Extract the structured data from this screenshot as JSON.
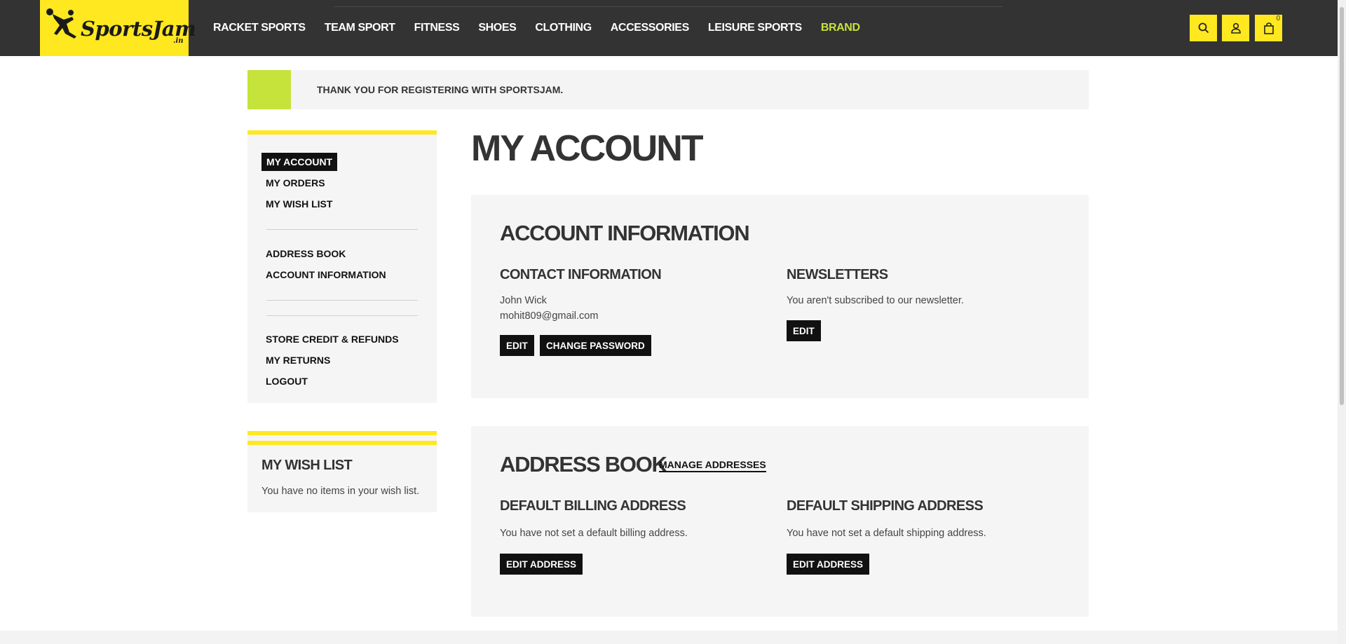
{
  "brand": {
    "logo_text": "SportsJam",
    "logo_sub": ".in",
    "colors": {
      "header_bg": "#333333",
      "accent_yellow": "#ffe81f",
      "accent_green": "#c5e33a",
      "button_bg": "#111111"
    }
  },
  "nav": {
    "items": [
      "RACKET SPORTS",
      "TEAM SPORT",
      "FITNESS",
      "SHOES",
      "CLOTHING",
      "ACCESSORIES",
      "LEISURE SPORTS",
      "BRAND"
    ]
  },
  "header_icons": {
    "search": "search-icon",
    "account": "user-icon",
    "cart": "shopping-bag-icon",
    "cart_count": "0"
  },
  "notice": {
    "text": "Thank you for registering with SportsJam."
  },
  "sidebar": {
    "items": [
      {
        "label": "MY ACCOUNT",
        "active": true
      },
      {
        "label": "MY ORDERS"
      },
      {
        "label": "MY WISH LIST"
      },
      {
        "label": "ADDRESS BOOK"
      },
      {
        "label": "ACCOUNT INFORMATION"
      },
      {
        "label": "STORE CREDIT & REFUNDS"
      },
      {
        "label": "MY RETURNS"
      },
      {
        "label": "LOGOUT"
      }
    ]
  },
  "wishlist": {
    "title": "MY WISH LIST",
    "text": "You have no items in your wish list."
  },
  "main": {
    "title": "MY ACCOUNT",
    "account_info": {
      "title": "ACCOUNT INFORMATION",
      "contact": {
        "title": "CONTACT INFORMATION",
        "name": "John Wick",
        "email": "mohit809@gmail.com",
        "edit_label": "EDIT",
        "change_password_label": "CHANGE PASSWORD"
      },
      "newsletters": {
        "title": "NEWSLETTERS",
        "text": "You aren't subscribed to our newsletter.",
        "edit_label": "EDIT"
      }
    },
    "address_book": {
      "title": "ADDRESS BOOK",
      "manage_label": "MANAGE ADDRESSES",
      "billing": {
        "title": "DEFAULT BILLING ADDRESS",
        "text": "You have not set a default billing address.",
        "edit_label": "EDIT ADDRESS"
      },
      "shipping": {
        "title": "DEFAULT SHIPPING ADDRESS",
        "text": "You have not set a default shipping address.",
        "edit_label": "EDIT ADDRESS"
      }
    }
  }
}
